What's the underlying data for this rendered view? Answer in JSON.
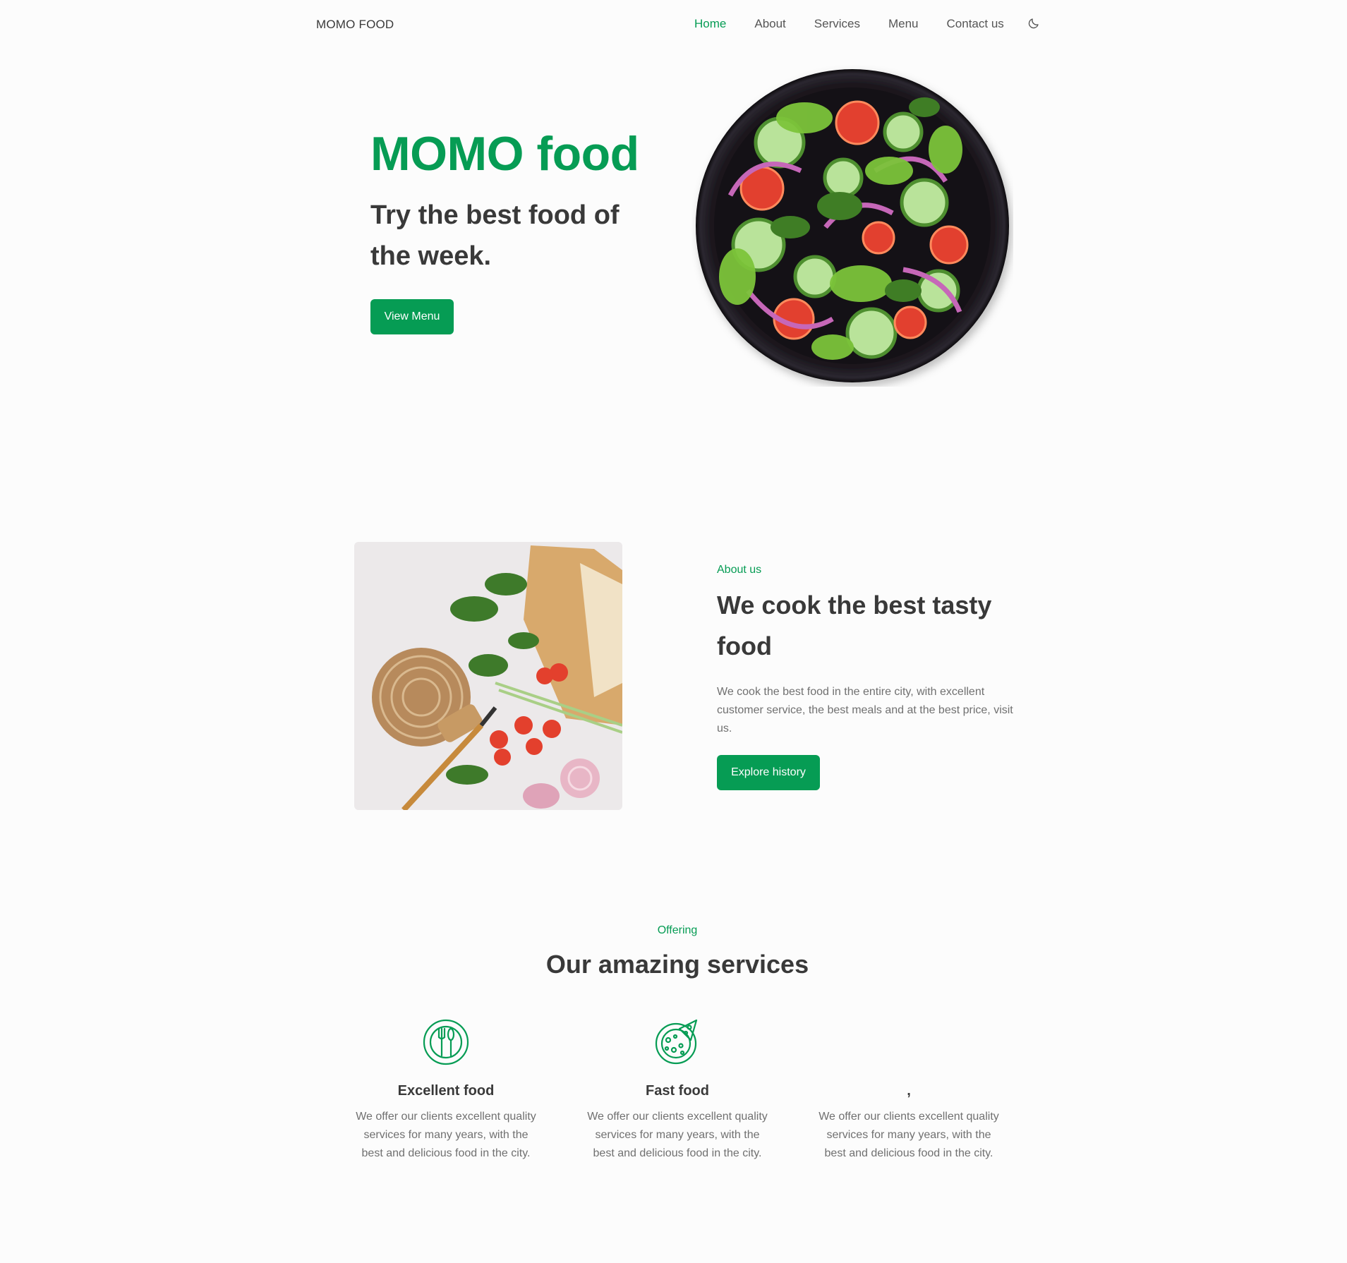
{
  "nav": {
    "logo": "MOMO FOOD",
    "links": [
      "Home",
      "About",
      "Services",
      "Menu",
      "Contact us"
    ],
    "active_link": "Home",
    "theme_icon": "moon-icon"
  },
  "hero": {
    "title": "MOMO food",
    "subtitle": "Try the best food of the week.",
    "button_label": "View Menu",
    "image": "salad-bowl-image"
  },
  "about": {
    "kicker": "About us",
    "title": "We cook the best tasty food",
    "text": "We cook the best food in the entire city, with excellent customer service, the best meals and at the best price, visit us.",
    "button_label": "Explore history",
    "image": "ingredients-image"
  },
  "services": {
    "kicker": "Offering",
    "title": "Our amazing services",
    "items": [
      {
        "name": "Excellent food",
        "icon": "cutlery-plate-icon",
        "description": "We offer our clients excellent quality services for many years, with the best and delicious food in the city."
      },
      {
        "name": "Fast food",
        "icon": "pizza-icon",
        "description": "We offer our clients excellent quality services for many years, with the best and delicious food in the city."
      },
      {
        "name": ",",
        "icon": "",
        "description": "We offer our clients excellent quality services for many years, with the best and delicious food in the city."
      }
    ]
  },
  "colors": {
    "accent": "#069c54",
    "heading": "#393939",
    "text": "#707070",
    "background": "#fcfcfc"
  }
}
